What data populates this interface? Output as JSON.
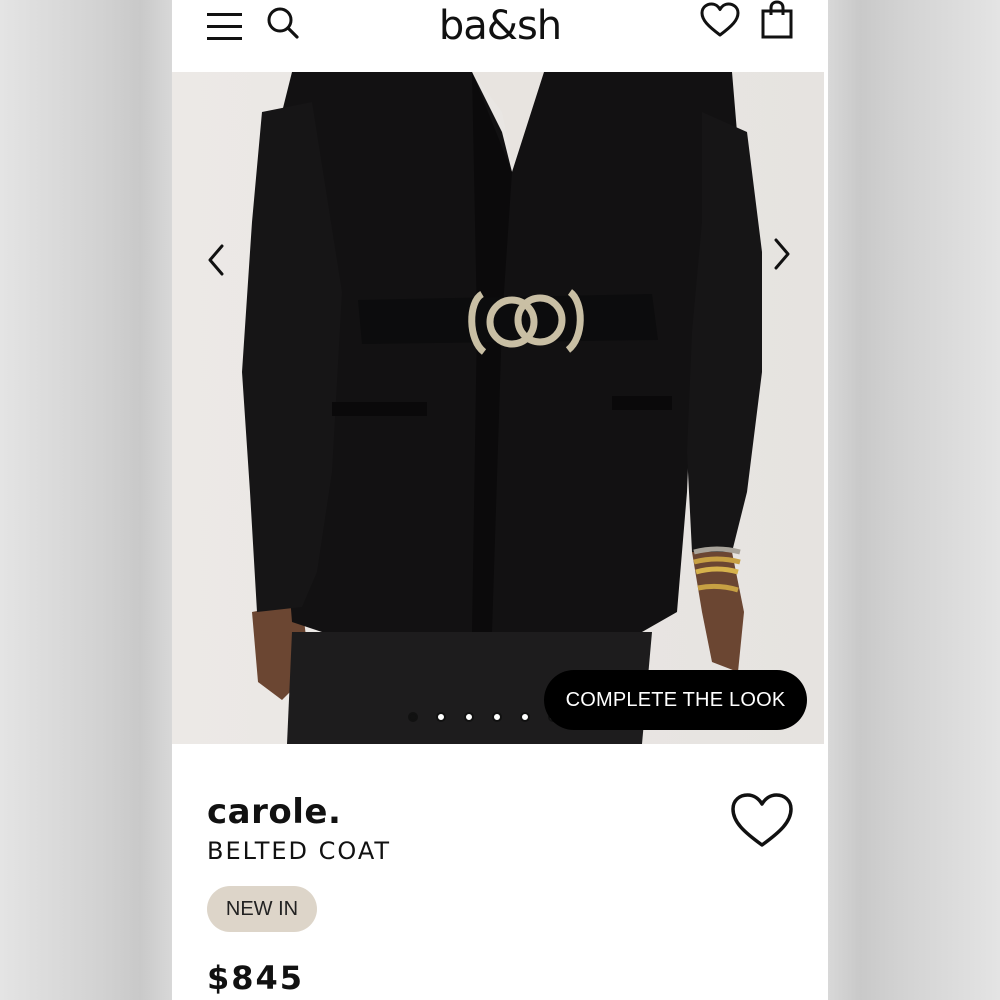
{
  "header": {
    "logo": "ba&sh",
    "menu_icon": "menu-icon",
    "search_icon": "search-icon",
    "wishlist_icon": "heart-icon",
    "bag_icon": "shopping-bag-icon"
  },
  "gallery": {
    "prev_icon": "chevron-left-icon",
    "next_icon": "chevron-right-icon",
    "dots_visible": 6,
    "active_index": 0,
    "cta_label": "COMPLETE THE LOOK"
  },
  "product": {
    "brand": "carole.",
    "name": "BELTED COAT",
    "badge": "NEW IN",
    "price": "$845"
  },
  "colors": {
    "accent": "#000000",
    "badge_bg": "#ddd5c9"
  }
}
